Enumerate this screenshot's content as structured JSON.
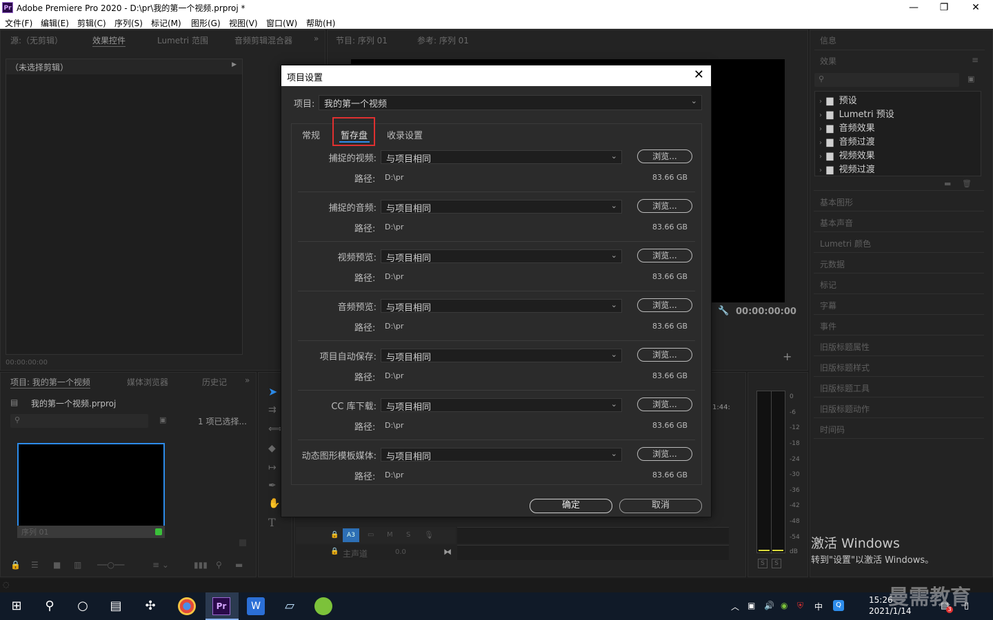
{
  "titlebar": {
    "logo": "Pr",
    "title": "Adobe Premiere Pro 2020 - D:\\pr\\我的第一个视频.prproj *",
    "minimize": "—",
    "maximize": "❐",
    "close": "✕"
  },
  "menu": [
    "文件(F)",
    "编辑(E)",
    "剪辑(C)",
    "序列(S)",
    "标记(M)",
    "图形(G)",
    "视图(V)",
    "窗口(W)",
    "帮助(H)"
  ],
  "source_panel": {
    "tabs": [
      "源:（无剪辑）",
      "效果控件",
      "Lumetri 范围",
      "音频剪辑混合器"
    ],
    "no_clip": "（未选择剪辑）",
    "timecode": "00:00:00:00"
  },
  "program_panel": {
    "tabs": [
      "节目: 序列 01",
      "参考: 序列 01"
    ],
    "timecode": "00:00:00:00"
  },
  "project_panel": {
    "tabs": [
      "项目: 我的第一个视频",
      "媒体浏览器",
      "历史记"
    ],
    "file": "我的第一个视频.prproj",
    "selected": "1 项已选择...",
    "seq_name": "序列 01"
  },
  "timeline": {
    "track_a3": "A3",
    "track_m": "M",
    "track_s": "S",
    "master": "主声道",
    "master_val": "0.0",
    "time_mark": "1:44:"
  },
  "meter": {
    "ticks": [
      "0",
      "-6",
      "-12",
      "-18",
      "-24",
      "-30",
      "-36",
      "-42",
      "-48",
      "-54",
      "dB"
    ],
    "s1": "S",
    "s2": "S"
  },
  "right_panel": {
    "info": "信息",
    "effects": "效果",
    "fx_items": [
      "预设",
      "Lumetri 预设",
      "音频效果",
      "音频过渡",
      "视频效果",
      "视频过渡"
    ],
    "sections": [
      "基本图形",
      "基本声音",
      "Lumetri 颜色",
      "元数据",
      "标记",
      "字幕",
      "事件",
      "旧版标题属性",
      "旧版标题样式",
      "旧版标题工具",
      "旧版标题动作",
      "时间码"
    ]
  },
  "dialog": {
    "title": "项目设置",
    "close": "✕",
    "project_label": "项目:",
    "project_value": "我的第一个视频",
    "tabs": [
      "常规",
      "暂存盘",
      "收录设置"
    ],
    "rows": [
      {
        "label": "捕捉的视频:",
        "value": "与项目相同",
        "browse": "浏览...",
        "path_label": "路径:",
        "path": "D:\\pr",
        "size": "83.66 GB"
      },
      {
        "label": "捕捉的音频:",
        "value": "与项目相同",
        "browse": "浏览...",
        "path_label": "路径:",
        "path": "D:\\pr",
        "size": "83.66 GB"
      },
      {
        "label": "视频预览:",
        "value": "与项目相同",
        "browse": "浏览...",
        "path_label": "路径:",
        "path": "D:\\pr",
        "size": "83.66 GB"
      },
      {
        "label": "音频预览:",
        "value": "与项目相同",
        "browse": "浏览...",
        "path_label": "路径:",
        "path": "D:\\pr",
        "size": "83.66 GB"
      },
      {
        "label": "项目自动保存:",
        "value": "与项目相同",
        "browse": "浏览...",
        "path_label": "路径:",
        "path": "D:\\pr",
        "size": "83.66 GB"
      },
      {
        "label": "CC 库下载:",
        "value": "与项目相同",
        "browse": "浏览...",
        "path_label": "路径:",
        "path": "D:\\pr",
        "size": "83.66 GB"
      },
      {
        "label": "动态图形模板媒体:",
        "value": "与项目相同",
        "browse": "浏览...",
        "path_label": "路径:",
        "path": "D:\\pr",
        "size": "83.66 GB"
      }
    ],
    "ok": "确定",
    "cancel": "取消"
  },
  "watermark": {
    "line1": "激活 Windows",
    "line2": "转到\"设置\"以激活 Windows。",
    "brand": "曼需教育"
  },
  "taskbar": {
    "time": "15:26",
    "date": "2021/1/14",
    "ime": "中",
    "notif": "3"
  },
  "colors": {
    "highlight": "#e03030",
    "accent": "#2d8ceb"
  }
}
